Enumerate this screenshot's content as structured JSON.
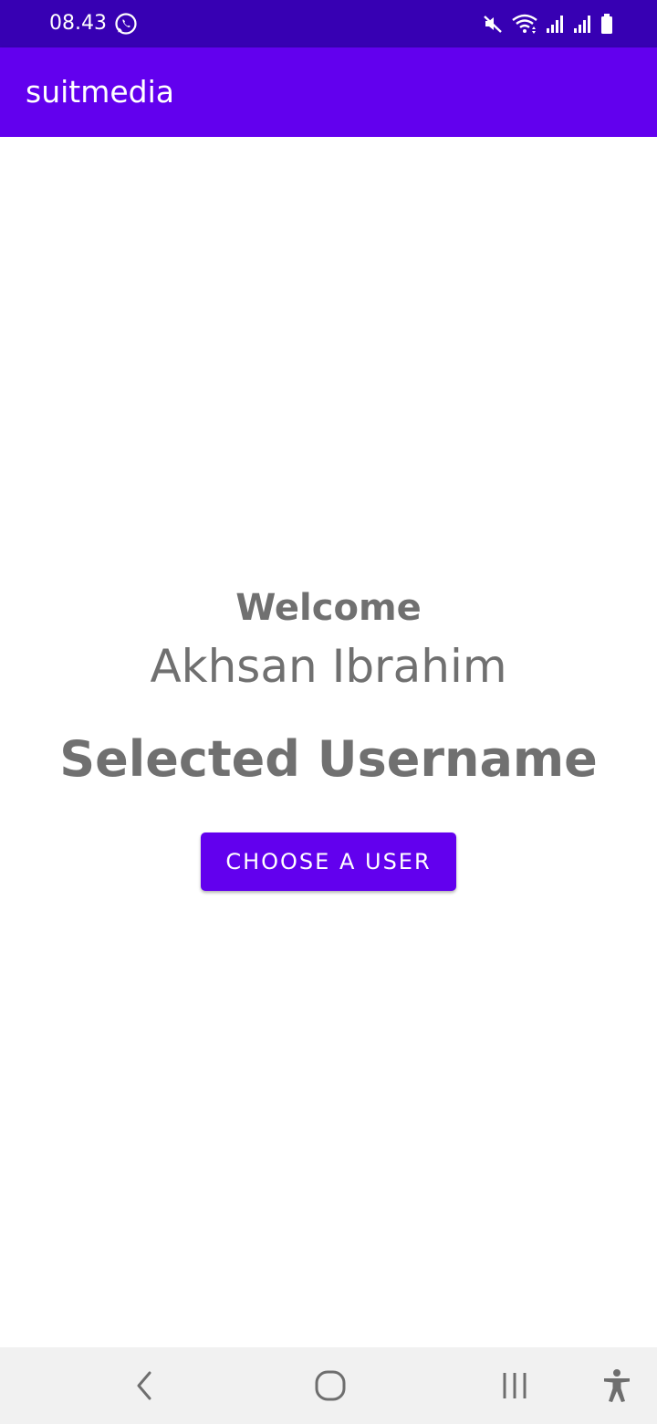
{
  "status_bar": {
    "time": "08.43",
    "icons": [
      "whatsapp-icon",
      "mute-icon",
      "wifi-icon",
      "signal-icon",
      "signal-icon",
      "battery-icon"
    ],
    "background": "#3700b3"
  },
  "app_bar": {
    "title": "suitmedia",
    "background": "#6200ee"
  },
  "main": {
    "welcome_label": "Welcome",
    "user_name": "Akhsan Ibrahim",
    "selected_username": "Selected Username",
    "choose_button_label": "CHOOSE A USER",
    "text_color": "#707070",
    "button_color": "#6200ee"
  },
  "nav_bar": {
    "buttons": [
      "back-icon",
      "home-icon",
      "recents-icon",
      "accessibility-icon"
    ]
  }
}
